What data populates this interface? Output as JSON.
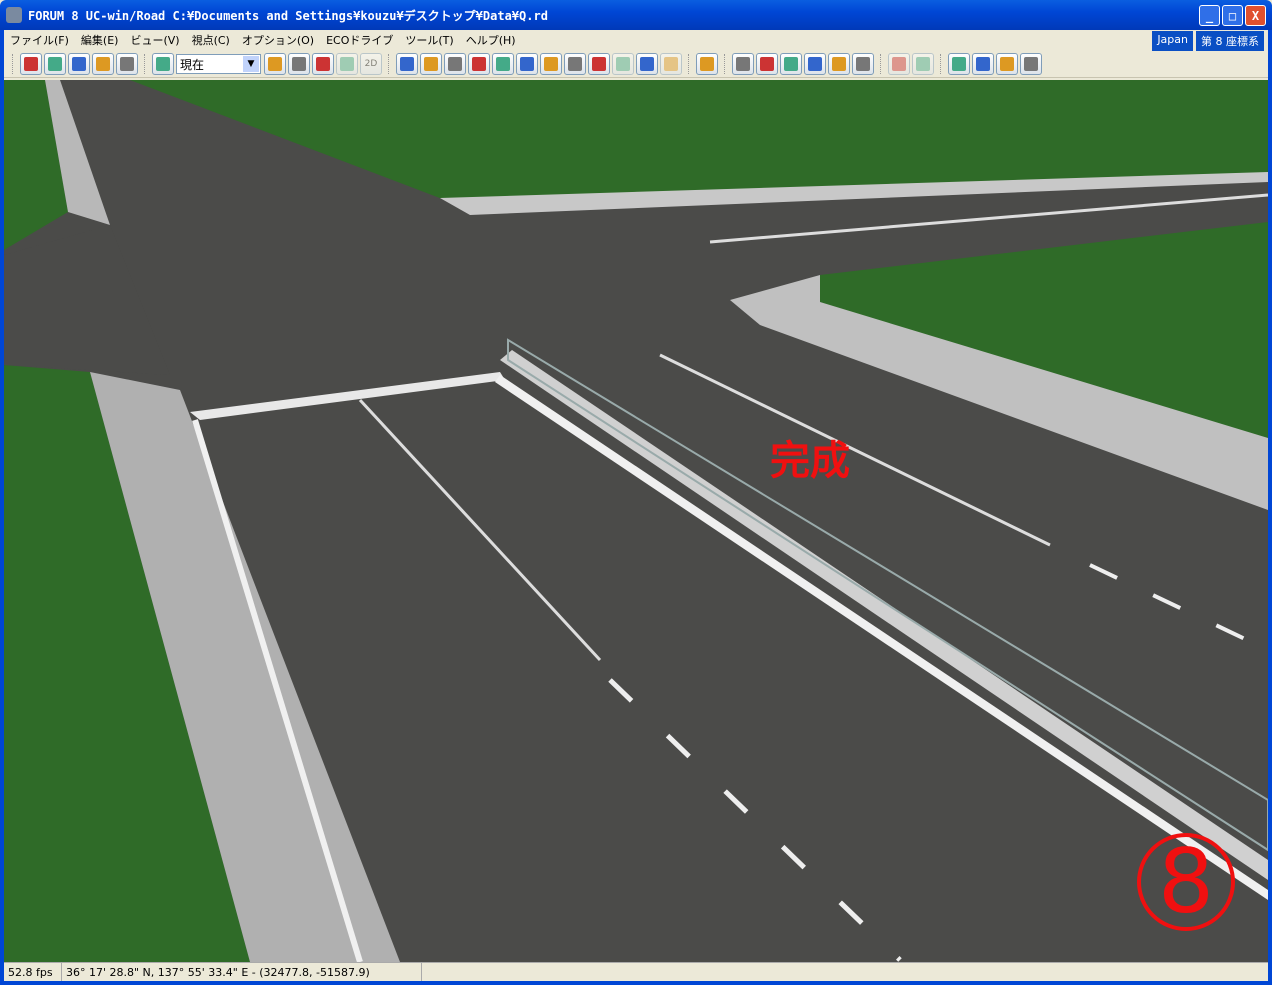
{
  "window": {
    "title": "FORUM 8   UC-win/Road   C:¥Documents and Settings¥kouzu¥デスクトップ¥Data¥Q.rd",
    "minimize": "_",
    "maximize": "□",
    "close": "X"
  },
  "menu": [
    "ファイル(F)",
    "編集(E)",
    "ビュー(V)",
    "視点(C)",
    "オプション(O)",
    "ECOドライブ",
    "ツール(T)",
    "ヘルプ(H)"
  ],
  "badges": {
    "region": "Japan",
    "coord_system": "第 8 座標系"
  },
  "toolbar": {
    "view_select": "現在",
    "icon_2d": "2D",
    "groups": [
      [
        "road-icon",
        "grid-icon",
        "building-icon",
        "people-icon",
        "trees-icon"
      ],
      [
        "road-view-icon",
        "#combo",
        "signal-play-icon",
        "signal-yellow-icon",
        "signal-red-icon",
        "weather-icon",
        "2d-icon"
      ],
      [
        "x-icon",
        "rotate-icon",
        "up-down-icon",
        "move-icon",
        "fly-icon",
        "orbit-icon",
        "edit-icon",
        "person-icon",
        "steering-icon",
        "drive-icon",
        "play-icon",
        "step-icon"
      ],
      [
        "ruler-icon"
      ],
      [
        "texture-icon",
        "tunnel-icon",
        "sign-icon",
        "cars-icon",
        "document-icon",
        "add-building-icon"
      ],
      [
        "camera-icon",
        "image-icon"
      ],
      [
        "new-file-icon",
        "open-folder-icon",
        "import-icon",
        "save-icon"
      ]
    ]
  },
  "scene": {
    "label": "完成",
    "step": "⑧",
    "colors": {
      "asphalt": "#4b4b49",
      "grass": "#2f6b28",
      "curb": "#bdbdbd",
      "line": "#e8e8e8",
      "annotation": "#f01010"
    }
  },
  "status": {
    "fps": "52.8 fps",
    "position": "36°  17' 28.8\" N, 137°  55' 33.4\" E  -  (32477.8, -51587.9)"
  }
}
